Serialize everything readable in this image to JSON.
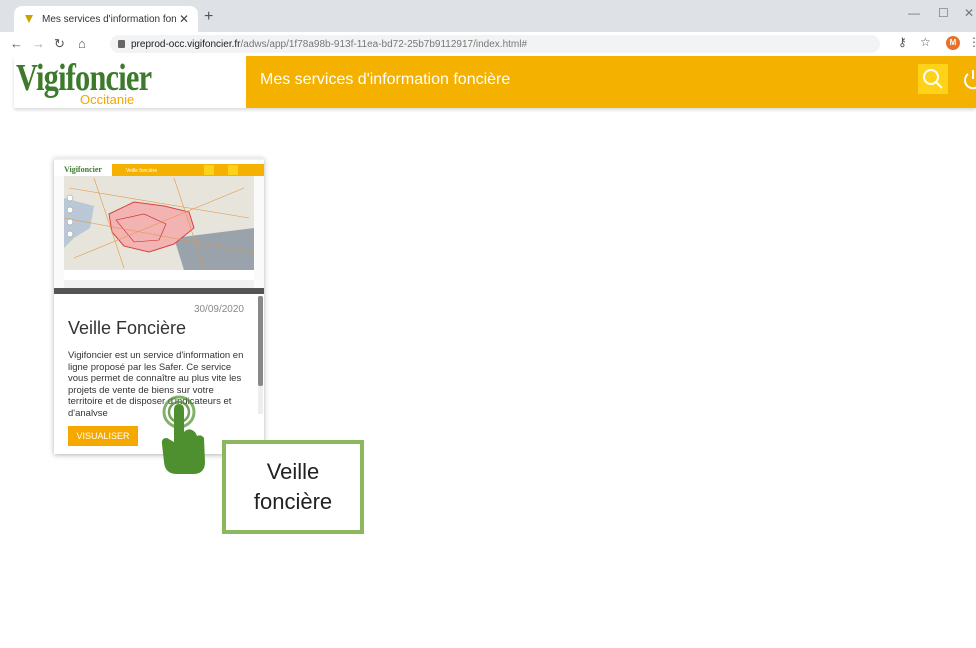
{
  "browser": {
    "tab_title": "Mes services d'information fonciè",
    "new_tab": "+",
    "close": "✕",
    "url_host": "preprod-occ.vigifoncier.fr",
    "url_path": "/adws/app/1f78a98b-913f-11ea-bd72-25b7b9112917/index.html#",
    "avatar_letter": "M"
  },
  "header": {
    "logo_main": "Vigifoncier",
    "logo_sub": "Occitanie",
    "title": "Mes services d'information foncière"
  },
  "card": {
    "date": "30/09/2020",
    "title": "Veille Foncière",
    "description": "Vigifoncier est un service d'information en ligne proposé par les Safer. Ce service vous permet de connaître au plus vite les projets de vente de biens sur votre territoire et de disposer d'indicateurs et d'analyse",
    "button": "VISUALISER",
    "thumb_title": "Veille foncière"
  },
  "callout": {
    "line1": "Veille",
    "line2": "foncière"
  },
  "colors": {
    "accent": "#f5b100",
    "logo_green": "#3e7a2b",
    "callout_border": "#8bb85e",
    "hand": "#4e8f2f"
  }
}
